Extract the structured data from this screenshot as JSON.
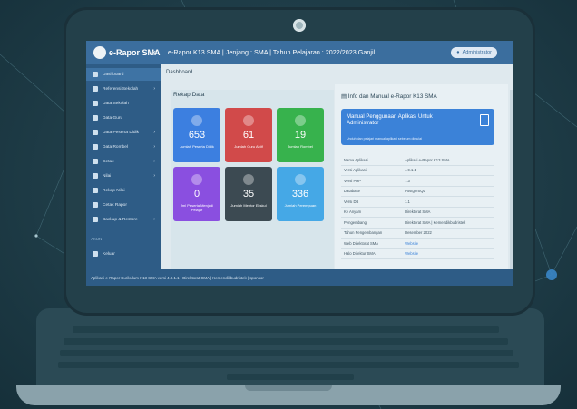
{
  "app": {
    "logo_text": "e-Rapor SMA",
    "title": "e-Rapor K13 SMA | Jenjang : SMA | Tahun Pelajaran : 2022/2023 Ganjil",
    "user_label": "Administrator",
    "menu_toggle_icon": "chevron-left-icon"
  },
  "sidebar": {
    "items": [
      {
        "label": "Dashboard",
        "icon": "home-icon",
        "active": true
      },
      {
        "label": "Referensi Sekolah",
        "icon": "tools-icon"
      },
      {
        "label": "Data Sekolah",
        "icon": "school-icon"
      },
      {
        "label": "Data Guru",
        "icon": "users-icon"
      },
      {
        "label": "Data Peserta Didik",
        "icon": "user-icon"
      },
      {
        "label": "Data Rombel",
        "icon": "table-icon"
      },
      {
        "label": "Cetak",
        "icon": "print-icon"
      },
      {
        "label": "Nilai",
        "icon": "star-icon"
      },
      {
        "label": "Rekap Nilai",
        "icon": "chart-icon"
      },
      {
        "label": "Cetak Rapor",
        "icon": "print-icon"
      },
      {
        "label": "Backup & Restore",
        "icon": "database-icon"
      }
    ],
    "section_label": "AKUN",
    "logout_label": "Keluar"
  },
  "content": {
    "breadcrumb": "Dashboard",
    "left_panel_title": "Rekap Data",
    "stats": [
      {
        "value": "653",
        "label": "Jumlah Peserta Didik",
        "color": "#3c7fe0"
      },
      {
        "value": "61",
        "label": "Jumlah Guru Aktif",
        "color": "#d14a4a"
      },
      {
        "value": "19",
        "label": "Jumlah Rombel",
        "color": "#37b24d"
      },
      {
        "value": "0",
        "label": "Jml Peserta Menjadi Pelajar",
        "color": "#8a4fe0"
      },
      {
        "value": "35",
        "label": "Jumlah Mentor Ekskul",
        "color": "#3c4a52"
      },
      {
        "value": "336",
        "label": "Jumlah Perempuan",
        "color": "#45a8e6"
      }
    ],
    "right_panel_title": "Info dan Manual e-Rapor K13 SMA",
    "manual": {
      "title": "Manual Penggunaan Aplikasi Untuk Administrator",
      "desc": "Unduh dan pelajari manual aplikasi sebelum dimulai"
    },
    "info_rows": [
      {
        "key": "Nama Aplikasi",
        "value": "Aplikasi e-Rapor K13 SMA"
      },
      {
        "key": "Versi Aplikasi",
        "value": "4.9.1.1"
      },
      {
        "key": "Versi PHP",
        "value": "7.3"
      },
      {
        "key": "Database",
        "value": "PostgreSQL"
      },
      {
        "key": "Versi DB",
        "value": "1.1"
      },
      {
        "key": "Ke Anyam",
        "value": "Direktorat SMA"
      },
      {
        "key": "Pengembang",
        "value": "Direktorat SMA | Kemendikbudristek"
      },
      {
        "key": "Tahun Pengembangan",
        "value": "Desember 2022"
      },
      {
        "key": "Web Direktorat SMA",
        "value": "Website",
        "link": true
      },
      {
        "key": "Halo Direktur SMA",
        "value": "Website",
        "link": true
      }
    ]
  },
  "footer": "Aplikasi e-Rapor Kurikulum K13 SMA versi 4.9.1.1 | Direktorat SMA | Kemendikbudristek | sponsor"
}
